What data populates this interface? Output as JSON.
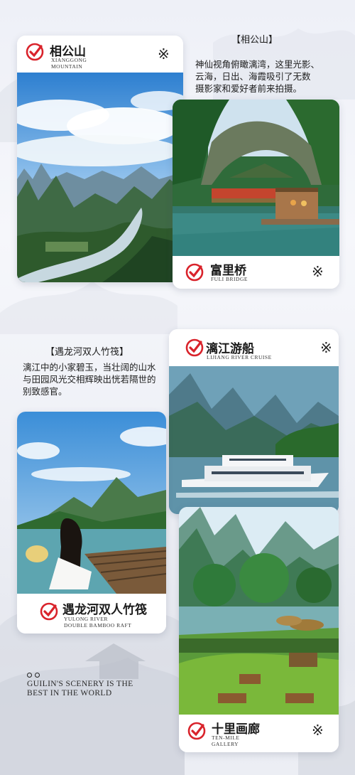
{
  "cards": {
    "xianggong": {
      "title": "相公山",
      "subtitle_line1": "XIANGGONG",
      "subtitle_line2": "MOUNTAIN",
      "mark": "※"
    },
    "fuli": {
      "title": "富里桥",
      "subtitle_line1": "FULI BRIDGE",
      "mark": "※"
    },
    "lijiang": {
      "title": "漓江游船",
      "subtitle_line1": "LIJIANG RIVER CRUISE",
      "mark": "※"
    },
    "yulong": {
      "title": "遇龙河双人竹筏",
      "subtitle_line1": "YULONG RIVER",
      "subtitle_line2": "DOUBLE BAMBOO RAFT"
    },
    "shili": {
      "title": "十里画廊",
      "subtitle_line1": "TEN-MILE",
      "subtitle_line2": "GALLERY",
      "mark": "※"
    }
  },
  "captions": {
    "xianggong": {
      "heading": "【相公山】",
      "lines": [
        "神仙视角俯瞰漓湾，这里光影、",
        "云海，日出、海霞吸引了无数",
        "摄影家和爱好者前来拍摄。"
      ]
    },
    "yulong": {
      "heading": "【遇龙河双人竹筏】",
      "lines": [
        "漓江中的小家碧玉，当壮阔的山水",
        "与田园风光交相辉映出恍若隔世的",
        "别致感官。"
      ]
    }
  },
  "slogan": {
    "line1": "GUILIN'S SCENERY IS THE",
    "line2": "BEST IN THE WORLD"
  },
  "icons": {
    "brand_mark": "checkmark-logo-icon",
    "decor": "asterisk-icon"
  },
  "colors": {
    "brand_red": "#d9232b",
    "background": "#eef0f7"
  }
}
